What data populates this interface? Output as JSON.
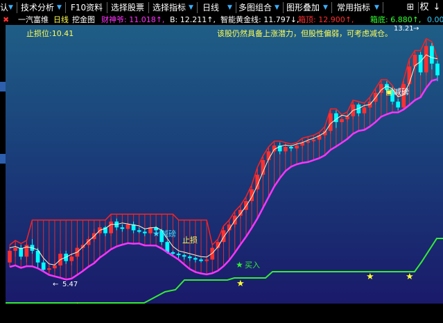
{
  "toolbar": {
    "items": [
      {
        "label": "认",
        "icon": "chevron-down-icon"
      },
      {
        "label": "技术分析",
        "icon": "chevron-down-icon"
      },
      {
        "label": "F10资料",
        "icon": ""
      },
      {
        "label": "选择股票",
        "icon": ""
      },
      {
        "label": "选择指标",
        "icon": "chevron-down-icon"
      },
      {
        "label": "日线",
        "icon": "chevron-down-icon"
      },
      {
        "label": "多图组合",
        "icon": "chevron-down-icon"
      },
      {
        "label": "图形叠加",
        "icon": "chevron-down-icon"
      },
      {
        "label": "常用指标",
        "icon": "chevron-down-icon"
      }
    ],
    "grid_icon": "grid-icon",
    "right_label": "权",
    "right_icon": "arrow-down-icon"
  },
  "infobar": {
    "close_icon": "✖",
    "stock_name": "一汽富维",
    "period": "日线",
    "indicator": "挖金图",
    "caishen": "财神爷: 11.018↑,",
    "b_value": "B: 12.211↑,",
    "gold_line": "智能黄金线: 11.797↓,",
    "box_top": "箱顶: 12.900↑,",
    "box_bottom": "箱底: 6.880↑,",
    "last_value": "0.00"
  },
  "colors": {
    "up": "#ff3030",
    "down": "#00ffff",
    "yellow_text": "#ffff55",
    "magenta_line": "#ff33ff",
    "green_line": "#33ee33",
    "red_line": "#ff2020",
    "white_line": "#fffacd",
    "accent_blue": "#3ab0ff"
  },
  "annotations": {
    "stop_loss_level": "止损位:10.41",
    "advice": "该股仍然具备上涨潜力，但股性偏弱，可考虑减仓。",
    "reduce_1": "减磅",
    "reduce_2": "减磅",
    "stop_loss": "止损",
    "buy": "买入",
    "low_price": "5.47",
    "high_price": "13.21"
  },
  "chart_data": {
    "type": "candlestick",
    "price_range": [
      5.2,
      13.4
    ],
    "high_label": 13.21,
    "low_label": 5.47,
    "stop_loss": 10.41,
    "candles": [
      [
        5.8,
        6.2,
        6.35,
        5.65
      ],
      [
        6.2,
        6.3,
        6.5,
        6.0
      ],
      [
        6.3,
        6.0,
        6.4,
        5.9
      ],
      [
        6.0,
        6.4,
        6.5,
        5.8
      ],
      [
        6.4,
        6.2,
        6.6,
        6.1
      ],
      [
        6.2,
        5.8,
        6.3,
        5.6
      ],
      [
        5.8,
        5.55,
        5.9,
        5.5
      ],
      [
        5.55,
        5.6,
        5.7,
        5.45
      ],
      [
        5.6,
        5.7,
        5.85,
        5.5
      ],
      [
        5.7,
        6.1,
        6.2,
        5.6
      ],
      [
        6.1,
        5.85,
        6.2,
        5.75
      ],
      [
        5.85,
        6.0,
        6.1,
        5.7
      ],
      [
        6.0,
        6.3,
        6.4,
        5.9
      ],
      [
        6.3,
        6.4,
        6.55,
        6.2
      ],
      [
        6.4,
        6.6,
        6.7,
        6.3
      ],
      [
        6.6,
        6.8,
        6.95,
        6.5
      ],
      [
        6.8,
        7.0,
        7.1,
        6.7
      ],
      [
        7.0,
        6.8,
        7.05,
        6.7
      ],
      [
        6.8,
        7.2,
        7.3,
        6.7
      ],
      [
        7.2,
        7.0,
        7.3,
        6.9
      ],
      [
        7.0,
        6.95,
        7.1,
        6.85
      ],
      [
        6.95,
        7.1,
        7.15,
        6.9
      ],
      [
        7.1,
        6.9,
        7.2,
        6.8
      ],
      [
        6.9,
        6.85,
        7.0,
        6.8
      ],
      [
        6.85,
        6.8,
        6.95,
        6.7
      ],
      [
        6.8,
        7.0,
        7.05,
        6.75
      ],
      [
        7.0,
        6.9,
        7.05,
        6.85
      ],
      [
        6.9,
        6.5,
        6.95,
        6.4
      ],
      [
        6.5,
        6.15,
        6.55,
        6.1
      ],
      [
        6.15,
        6.1,
        6.2,
        6.0
      ],
      [
        6.1,
        6.05,
        6.15,
        5.95
      ],
      [
        6.05,
        6.0,
        6.1,
        5.9
      ],
      [
        6.0,
        5.95,
        6.05,
        5.85
      ],
      [
        5.95,
        5.9,
        6.0,
        5.8
      ],
      [
        5.9,
        5.85,
        5.95,
        5.8
      ],
      [
        5.85,
        5.9,
        5.95,
        5.8
      ],
      [
        5.9,
        6.3,
        6.35,
        5.9
      ],
      [
        6.3,
        6.5,
        6.55,
        6.2
      ],
      [
        6.5,
        6.9,
        7.0,
        6.45
      ],
      [
        6.9,
        7.1,
        7.2,
        6.8
      ],
      [
        7.1,
        7.4,
        7.5,
        7.0
      ],
      [
        7.4,
        7.6,
        7.7,
        7.3
      ],
      [
        7.6,
        7.9,
        8.0,
        7.5
      ],
      [
        7.9,
        8.3,
        8.4,
        7.8
      ],
      [
        8.3,
        8.8,
        9.0,
        8.2
      ],
      [
        8.8,
        9.3,
        9.4,
        8.7
      ],
      [
        9.3,
        9.6,
        9.7,
        9.2
      ],
      [
        9.6,
        9.8,
        9.9,
        9.5
      ],
      [
        9.8,
        9.6,
        9.9,
        9.5
      ],
      [
        9.6,
        9.75,
        9.85,
        9.5
      ],
      [
        9.75,
        9.7,
        9.8,
        9.6
      ],
      [
        9.7,
        9.8,
        9.85,
        9.6
      ],
      [
        9.8,
        9.9,
        10.0,
        9.7
      ],
      [
        9.9,
        9.95,
        10.05,
        9.85
      ],
      [
        9.95,
        10.0,
        10.1,
        9.9
      ],
      [
        10.0,
        10.15,
        10.2,
        9.9
      ],
      [
        10.15,
        10.3,
        10.4,
        10.05
      ],
      [
        10.3,
        10.9,
        11.0,
        10.2
      ],
      [
        10.9,
        10.6,
        11.0,
        10.4
      ],
      [
        10.6,
        10.7,
        10.8,
        10.5
      ],
      [
        10.7,
        10.8,
        10.9,
        10.6
      ],
      [
        10.8,
        11.2,
        11.3,
        10.7
      ],
      [
        11.2,
        10.9,
        11.25,
        10.8
      ],
      [
        10.9,
        11.1,
        11.2,
        10.8
      ],
      [
        11.1,
        11.3,
        11.4,
        11.0
      ],
      [
        11.3,
        11.6,
        11.7,
        11.2
      ],
      [
        11.6,
        11.9,
        12.0,
        11.5
      ],
      [
        11.9,
        11.7,
        12.0,
        11.6
      ],
      [
        11.7,
        11.3,
        11.8,
        11.2
      ],
      [
        11.3,
        11.1,
        11.4,
        11.0
      ],
      [
        11.1,
        11.9,
        12.0,
        11.0
      ],
      [
        11.9,
        12.5,
        12.7,
        11.8
      ],
      [
        12.5,
        12.9,
        13.0,
        12.3
      ],
      [
        12.9,
        12.3,
        13.0,
        12.2
      ],
      [
        12.3,
        13.2,
        13.4,
        12.2
      ],
      [
        13.2,
        12.6,
        13.3,
        12.4
      ],
      [
        12.6,
        12.2,
        12.7,
        12.0
      ]
    ]
  }
}
